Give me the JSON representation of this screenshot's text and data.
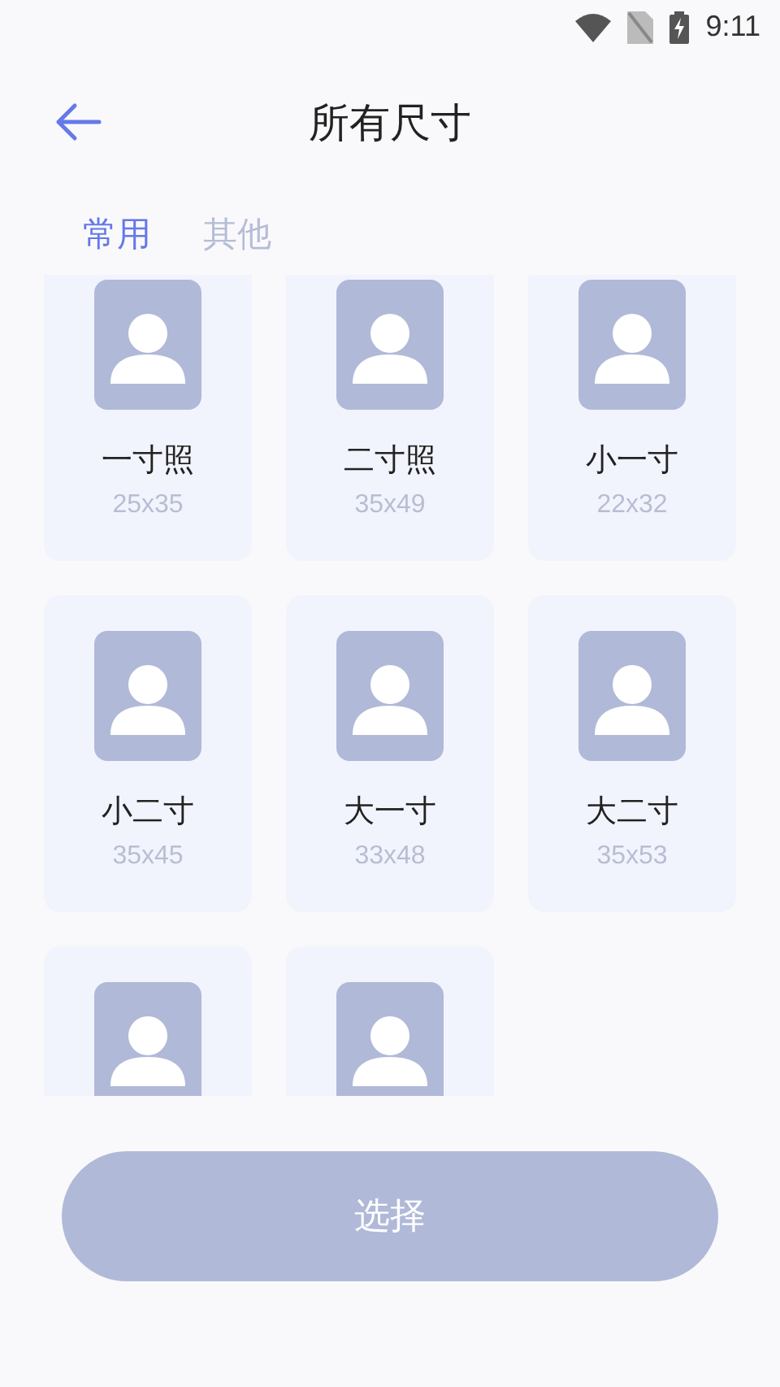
{
  "status_bar": {
    "time": "9:11"
  },
  "header": {
    "title": "所有尺寸"
  },
  "tabs": [
    {
      "label": "常用",
      "selected": true
    },
    {
      "label": "其他",
      "selected": false
    }
  ],
  "sizes": [
    {
      "kind": "labeled",
      "label": "一寸照",
      "size": "25x35"
    },
    {
      "kind": "labeled",
      "label": "二寸照",
      "size": "35x49"
    },
    {
      "kind": "labeled",
      "label": "小一寸",
      "size": "22x32"
    },
    {
      "kind": "labeled",
      "label": "小二寸",
      "size": "35x45"
    },
    {
      "kind": "labeled",
      "label": "大一寸",
      "size": "33x48"
    },
    {
      "kind": "labeled",
      "label": "大二寸",
      "size": "35x53"
    },
    {
      "kind": "clipped"
    },
    {
      "kind": "clipped"
    }
  ],
  "button": {
    "label": "选择"
  }
}
